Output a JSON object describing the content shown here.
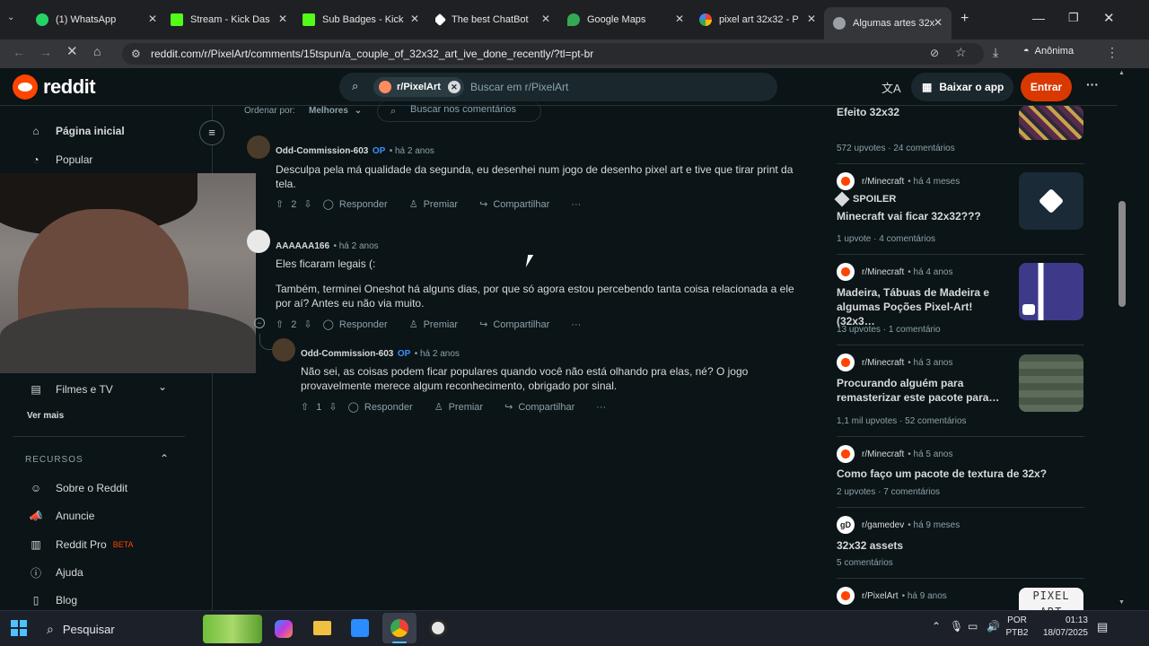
{
  "browser": {
    "tabs": [
      {
        "label": "(1) WhatsApp",
        "icon": "whatsapp-icon",
        "color": "#25d366"
      },
      {
        "label": "Stream - Kick Das",
        "icon": "kick-icon",
        "color": "#53fc18"
      },
      {
        "label": "Sub Badges - Kick",
        "icon": "kick-icon",
        "color": "#53fc18"
      },
      {
        "label": "The best ChatBot",
        "icon": "chatbot-icon",
        "color": "#ffffff"
      },
      {
        "label": "Google Maps",
        "icon": "maps-icon",
        "color": "#34a853"
      },
      {
        "label": "pixel art 32x32 - P",
        "icon": "google-icon",
        "color": "#4285f4"
      },
      {
        "label": "Algumas artes 32x",
        "icon": "reddit-icon",
        "color": "#9aa0a6"
      }
    ],
    "url": "reddit.com/r/PixelArt/comments/15tspun/a_couple_of_32x32_art_ive_done_recently/?tl=pt-br",
    "incognito_label": "Anônima"
  },
  "reddit": {
    "logo_text": "reddit",
    "search_chip": "r/PixelArt",
    "search_placeholder": "Buscar em r/PixelArt",
    "download_app": "Baixar o app",
    "login": "Entrar",
    "sort_label": "Ordenar por:",
    "sort_value": "Melhores",
    "comment_search_placeholder": "Buscar nos comentários"
  },
  "leftnav": {
    "home": "Página inicial",
    "popular": "Popular",
    "movies": "Filmes e TV",
    "see_more": "Ver mais",
    "resources_heading": "RECURSOS",
    "about": "Sobre o Reddit",
    "advertise": "Anuncie",
    "pro": "Reddit Pro",
    "pro_badge": "BETA",
    "help": "Ajuda",
    "blog": "Blog"
  },
  "comments": [
    {
      "user": "Odd-Commission-603",
      "op": "OP",
      "time": "• há 2 anos",
      "text": "Desculpa pela má qualidade da segunda, eu desenhei num jogo de desenho pixel art e tive que tirar print da tela.",
      "votes": "2"
    },
    {
      "user": "AAAAAA166",
      "time": "• há 2 anos",
      "text1": "Eles ficaram legais (:",
      "text2": "Também, terminei Oneshot há alguns dias, por que só agora estou percebendo tanta coisa relacionada a ele por aí? Antes eu não via muito.",
      "votes": "2"
    },
    {
      "user": "Odd-Commission-603",
      "op": "OP",
      "time": "• há 2 anos",
      "text": "Não sei, as coisas podem ficar populares quando você não está olhando pra elas, né? O jogo provavelmente merece algum reconhecimento, obrigado por sinal.",
      "votes": "1"
    }
  ],
  "actions": {
    "reply": "Responder",
    "award": "Premiar",
    "share": "Compartilhar",
    "more": "···"
  },
  "related": [
    {
      "title": "Efeito 32x32",
      "stats": "572 upvotes  ·  24 comentários"
    },
    {
      "sub": "r/Minecraft",
      "time": "• há 4 meses",
      "spoiler": "SPOILER",
      "title": "Minecraft vai ficar 32x32???",
      "stats": "1 upvote  ·  4 comentários"
    },
    {
      "sub": "r/Minecraft",
      "time": "• há 4 anos",
      "title": "Madeira, Tábuas de Madeira e algumas Poções Pixel-Art! (32x3…",
      "stats": "13 upvotes  ·  1 comentário"
    },
    {
      "sub": "r/Minecraft",
      "time": "• há 3 anos",
      "title": "Procurando alguém para remasterizar este pacote para…",
      "stats": "1,1 mil upvotes  ·  52 comentários"
    },
    {
      "sub": "r/Minecraft",
      "time": "• há 5 anos",
      "title": "Como faço um pacote de textura de 32x?",
      "stats": "2 upvotes  ·  7 comentários"
    },
    {
      "sub": "r/gamedev",
      "time": "• há 9 meses",
      "title": "32x32 assets",
      "stats": "5 comentários"
    },
    {
      "sub": "r/PixelArt",
      "time": "• há 9 anos",
      "thumb_text": "PIXEL ART"
    }
  ],
  "taskbar": {
    "search": "Pesquisar",
    "lang1": "POR",
    "lang2": "PTB2",
    "time": "01:13",
    "date": "18/07/2025"
  },
  "colors": {
    "brand": "#ff4500",
    "op": "#3b8fff",
    "login_bg": "#d93900",
    "beta": "#ff4500"
  }
}
